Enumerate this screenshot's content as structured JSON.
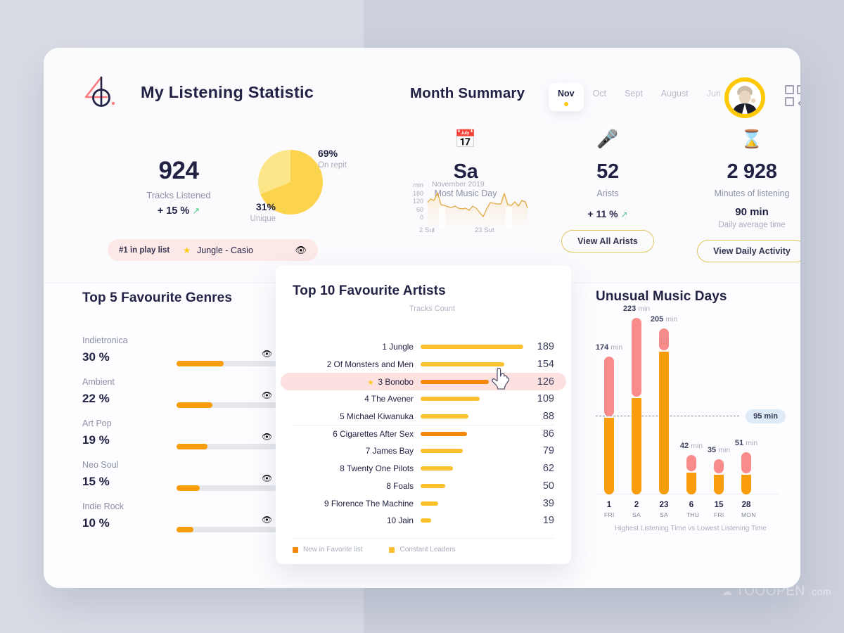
{
  "brand": {
    "logo_text": "40",
    "logo_colors": {
      "four": "#f97b7b",
      "zero": "#222344"
    }
  },
  "header": {
    "page_title": "My Listening Statistic",
    "month_title": "Month Summary",
    "months": [
      {
        "label": "Nov",
        "active": true
      },
      {
        "label": "Oct",
        "active": false
      },
      {
        "label": "Sept",
        "active": false
      },
      {
        "label": "August",
        "active": false
      },
      {
        "label": "Jun",
        "active": false
      }
    ],
    "avatar_name": "avatar",
    "grid_icon": "grid-icon"
  },
  "tracks": {
    "value": "924",
    "label": "Tracks Listened",
    "delta": "+ 15 %",
    "delta_arrow": "↗"
  },
  "pie": {
    "on_repeat_pct": "69%",
    "on_repeat_label": "On repit",
    "unique_pct": "31%",
    "unique_label": "Unique",
    "colors": {
      "on_repeat": "#fcd34d",
      "unique": "#fde68a"
    }
  },
  "playlist": {
    "rank": "#1 in play list",
    "star": "★",
    "track": "Jungle - Casio",
    "eye_icon": "eye-icon"
  },
  "summary": {
    "most_music_day": {
      "icon": "calendar-icon",
      "value": "Sa",
      "label": "Most Music Day"
    },
    "artists": {
      "icon": "microphone-icon",
      "value": "52",
      "label": "Arists",
      "delta": "+ 11 %",
      "delta_arrow": "↗",
      "button": "View All Arists"
    },
    "minutes": {
      "icon": "hourglass-icon",
      "value": "2 928",
      "label": "Minutes of listening",
      "sub_value": "90 min",
      "sub_label": "Daily average time",
      "button": "View Daily Activity"
    }
  },
  "chart_data": [
    {
      "type": "pie",
      "title": "Listening split",
      "categories": [
        "On repit",
        "Unique"
      ],
      "values": [
        69,
        31
      ],
      "unit": "%"
    },
    {
      "type": "area",
      "title": "November 2019",
      "ylabel": "min",
      "yticks": [
        "180",
        "120",
        "60",
        "0"
      ],
      "ylim": [
        0,
        200
      ],
      "xticks": [
        "2 Sut",
        "23 Sut"
      ],
      "x": [
        1,
        2,
        3,
        4,
        5,
        6,
        7,
        8,
        9,
        10,
        11,
        12,
        13,
        14,
        15,
        16,
        17,
        18,
        19,
        20,
        21,
        22,
        23,
        24,
        25,
        26,
        27,
        28,
        29,
        30
      ],
      "values": [
        140,
        152,
        148,
        178,
        128,
        126,
        120,
        118,
        124,
        114,
        112,
        116,
        108,
        126,
        118,
        96,
        78,
        112,
        140,
        138,
        136,
        134,
        180,
        132,
        130,
        146,
        128,
        152,
        146,
        118
      ],
      "grid": false,
      "legend": "none"
    },
    {
      "type": "bar",
      "title": "Top 5 Favourite Genres",
      "orientation": "horizontal",
      "categories": [
        "Indietronica",
        "Ambient",
        "Art Pop",
        "Neo Soul",
        "Indie Rock"
      ],
      "values": [
        30,
        22,
        19,
        15,
        10
      ],
      "unit": "%",
      "xlim": [
        0,
        60
      ],
      "bar_color": "#f99d0c",
      "track_color": "#e6e7ec"
    },
    {
      "type": "bar",
      "title": "Top 10 Favourite Artists",
      "orientation": "horizontal",
      "xlabel": "Tracks Count",
      "categories": [
        "1 Jungle",
        "2 Of Monsters and Men",
        "3 Bonobo",
        "4 The Avener",
        "5 Michael Kiwanuka",
        "6 Cigarettes After Sex",
        "7 James Bay",
        "8 Twenty One Pilots",
        "8 Foals",
        "9 Florence The Machine",
        "10 Jain"
      ],
      "values": [
        189,
        154,
        126,
        109,
        88,
        86,
        79,
        62,
        50,
        39,
        19
      ],
      "xlim": [
        0,
        200
      ],
      "legend": [
        {
          "label": "New in Favorite list",
          "color": "#f5870b"
        },
        {
          "label": "Constant Leaders",
          "color": "#fbc02d"
        }
      ]
    },
    {
      "type": "bar",
      "title": "Unusual Music Days",
      "subtitle": "Highest Listening Time vs Lowest Listening Time",
      "categories": [
        "1 FRI",
        "2 SA",
        "23 SA",
        "6 THU",
        "15 FRI",
        "28 MON"
      ],
      "values": [
        174,
        223,
        205,
        42,
        35,
        51
      ],
      "unit": "min",
      "threshold": 95,
      "threshold_label": "95 min",
      "ylim": [
        0,
        240
      ],
      "colors": {
        "high": "#f98b8b",
        "low": "#f99d0c"
      }
    }
  ],
  "genres": {
    "title": "Top 5 Favourite Genres",
    "items": [
      {
        "name": "Indietronica",
        "pct": "30 %",
        "fill": 30
      },
      {
        "name": "Ambient",
        "pct": "22 %",
        "fill": 22
      },
      {
        "name": "Art Pop",
        "pct": "19 %",
        "fill": 19
      },
      {
        "name": "Neo Soul",
        "pct": "15 %",
        "fill": 15
      },
      {
        "name": "Indie  Rock",
        "pct": "10 %",
        "fill": 10
      }
    ]
  },
  "artists": {
    "title": "Top 10 Favourite Artists",
    "column_header": "Tracks Count",
    "rows": [
      {
        "name": "1 Jungle",
        "value": "189",
        "bar": 189,
        "new": false,
        "highlight": false,
        "star": false,
        "sep": false
      },
      {
        "name": "2 Of Monsters and Men",
        "value": "154",
        "bar": 154,
        "new": false,
        "highlight": false,
        "star": false,
        "sep": false
      },
      {
        "name": "3 Bonobo",
        "value": "126",
        "bar": 126,
        "new": true,
        "highlight": true,
        "star": true,
        "sep": false
      },
      {
        "name": "4 The Avener",
        "value": "109",
        "bar": 109,
        "new": false,
        "highlight": false,
        "star": false,
        "sep": false
      },
      {
        "name": "5 Michael Kiwanuka",
        "value": "88",
        "bar": 88,
        "new": false,
        "highlight": false,
        "star": false,
        "sep": false
      },
      {
        "name": "6 Cigarettes After Sex",
        "value": "86",
        "bar": 86,
        "new": true,
        "highlight": false,
        "star": false,
        "sep": true
      },
      {
        "name": "7 James Bay",
        "value": "79",
        "bar": 79,
        "new": false,
        "highlight": false,
        "star": false,
        "sep": false
      },
      {
        "name": "8 Twenty One Pilots",
        "value": "62",
        "bar": 62,
        "new": false,
        "highlight": false,
        "star": false,
        "sep": false
      },
      {
        "name": "8 Foals",
        "value": "50",
        "bar": 50,
        "new": false,
        "highlight": false,
        "star": false,
        "sep": false
      },
      {
        "name": "9 Florence The Machine",
        "value": "39",
        "bar": 39,
        "new": false,
        "highlight": false,
        "star": false,
        "sep": false
      },
      {
        "name": "10 Jain",
        "value": "19",
        "bar": 19,
        "new": false,
        "highlight": false,
        "star": false,
        "sep": false
      }
    ],
    "legend": [
      {
        "label": "New in Favorite list",
        "color": "#f5870b"
      },
      {
        "label": "Constant Leaders",
        "color": "#fbc02d"
      }
    ]
  },
  "unusual": {
    "title": "Unusual Music Days",
    "threshold_label": "95 min",
    "footer": "Highest Listening Time vs Lowest Listening Time",
    "bars": [
      {
        "day": "1",
        "weekday": "FRI",
        "label": "174",
        "unit": "min",
        "high": 174,
        "low": 95
      },
      {
        "day": "2",
        "weekday": "SA",
        "label": "223",
        "unit": "min",
        "high": 223,
        "low": 120
      },
      {
        "day": "23",
        "weekday": "SA",
        "label": "205",
        "unit": "min",
        "high": 205,
        "low": 178
      },
      {
        "day": "6",
        "weekday": "THU",
        "label": "42",
        "unit": "min",
        "high": 42,
        "low": 26
      },
      {
        "day": "15",
        "weekday": "FRI",
        "label": "35",
        "unit": "min",
        "high": 35,
        "low": 22
      },
      {
        "day": "28",
        "weekday": "MON",
        "label": "51",
        "unit": "min",
        "high": 51,
        "low": 24
      }
    ]
  },
  "sparkline": {
    "title": "November 2019",
    "unit": "min",
    "yticks": [
      "180",
      "120",
      "60",
      "0"
    ],
    "x_labels": [
      "2 Sut",
      "23 Sut"
    ]
  },
  "watermark": {
    "icon": "cloud-icon",
    "name": "TOOOPEN",
    "domain": ".com"
  }
}
